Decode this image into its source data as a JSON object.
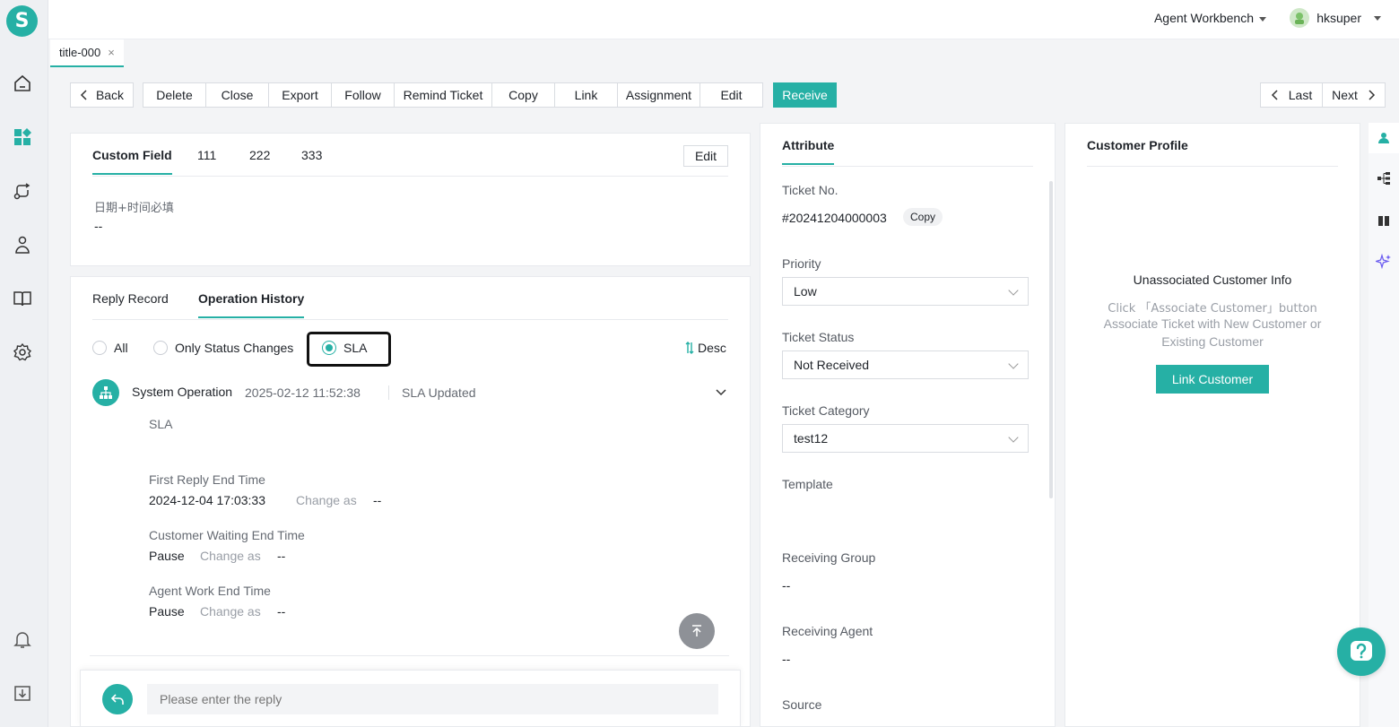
{
  "app": {
    "logo_letter": "S"
  },
  "header": {
    "workbench_label": "Agent Workbench",
    "username": "hksuper"
  },
  "page_tab": {
    "label": "title-000",
    "close": "×"
  },
  "toolbar": {
    "back": "Back",
    "delete": "Delete",
    "close": "Close",
    "export": "Export",
    "follow": "Follow",
    "remind": "Remind Ticket",
    "copy": "Copy",
    "link": "Link",
    "assignment": "Assignment",
    "edit": "Edit",
    "receive": "Receive",
    "last": "Last",
    "next": "Next"
  },
  "custom_field": {
    "tabs": [
      "Custom Field",
      "111",
      "222",
      "333"
    ],
    "edit_label": "Edit",
    "field_label": "日期+时间必填",
    "field_value": "--"
  },
  "history": {
    "tabs": [
      "Reply Record",
      "Operation History"
    ],
    "filters": [
      "All",
      "Only Status Changes",
      "SLA"
    ],
    "sort_label": "Desc",
    "entry": {
      "actor": "System Operation",
      "time": "2025-02-12 11:52:38",
      "action": "SLA Updated",
      "section": "SLA",
      "change_as": "Change as",
      "items": [
        {
          "label": "First Reply End Time",
          "from": "2024-12-04 17:03:33",
          "to": "--"
        },
        {
          "label": "Customer Waiting End Time",
          "from": "Pause",
          "to": "--"
        },
        {
          "label": "Agent Work End Time",
          "from": "Pause",
          "to": "--"
        }
      ]
    }
  },
  "reply": {
    "placeholder": "Please enter the reply"
  },
  "attribute": {
    "title": "Attribute",
    "ticket_no_label": "Ticket No.",
    "ticket_no": "#20241204000003",
    "copy_label": "Copy",
    "priority_label": "Priority",
    "priority": "Low",
    "status_label": "Ticket Status",
    "status": "Not Received",
    "category_label": "Ticket Category",
    "category": "test12",
    "template_label": "Template",
    "group_label": "Receiving Group",
    "group": "--",
    "agent_label": "Receiving Agent",
    "agent": "--",
    "source_label": "Source"
  },
  "profile": {
    "title": "Customer Profile",
    "empty_title": "Unassociated Customer Info",
    "empty_line1": "Click 「Associate Customer」button",
    "empty_line2": "Associate Ticket with New Customer or",
    "empty_line3": "Existing Customer",
    "link_button": "Link Customer"
  },
  "colors": {
    "accent": "#26b0a5",
    "focus_border": "#111111"
  }
}
